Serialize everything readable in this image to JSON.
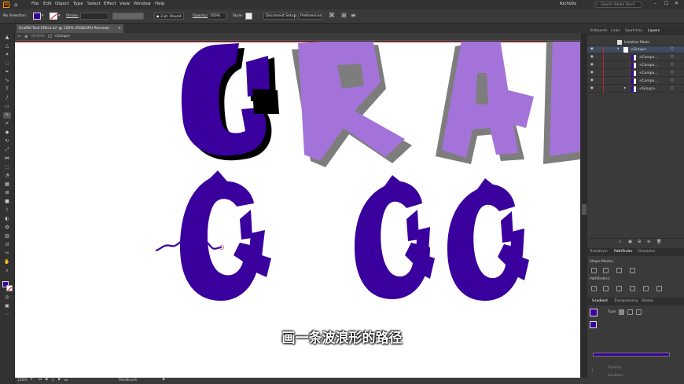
{
  "menubar": {
    "items": [
      "File",
      "Edit",
      "Object",
      "Type",
      "Select",
      "Effect",
      "View",
      "Window",
      "Help"
    ],
    "user": "RichGfx",
    "search_placeholder": "Search Adobe Stock"
  },
  "control": {
    "selection": "No Selection",
    "stroke_label": "Stroke:",
    "brush": "3 pt. Round",
    "opacity_label": "Opacity:",
    "opacity_value": "100%",
    "style_label": "Style:",
    "document_setup": "Document Setup",
    "preferences": "Preferences"
  },
  "document": {
    "tab_title": "Graffiti Text Effect.ai* @ 150% (RGB/GPU Preview)",
    "breadcrumb_1": "RichGfx",
    "breadcrumb_2": "<Group>"
  },
  "layers_panel": {
    "tabs": [
      "Artboards",
      "Links",
      "Swatches",
      "Layers"
    ],
    "isolation": "Isolation Mode",
    "rows": [
      "<Group>",
      "<Compo...",
      "<Compo...",
      "<Compo...",
      "<Compo...",
      "<Group>"
    ]
  },
  "pathfinder_panel": {
    "tabs": [
      "Transform",
      "Pathfinder",
      "Character"
    ],
    "shape_modes": "Shape Modes:",
    "pathfinders": "Pathfinders:"
  },
  "gradient_panel": {
    "tabs": [
      "Gradient",
      "Transparency",
      "Stroke"
    ],
    "type_label": "Type:",
    "opacity_label": "Opacity:",
    "location_label": "Location:"
  },
  "status": {
    "zoom": "150%",
    "page": "1",
    "tool": "Paintbrush"
  },
  "subtitle": "画一条波浪形的路径",
  "colors": {
    "purple": "#3a009e",
    "lavender": "#a473d9",
    "gray": "#7d7d7d",
    "shadow": "#000000",
    "accent": "#c2272d",
    "highlight": "#4a90d9"
  }
}
